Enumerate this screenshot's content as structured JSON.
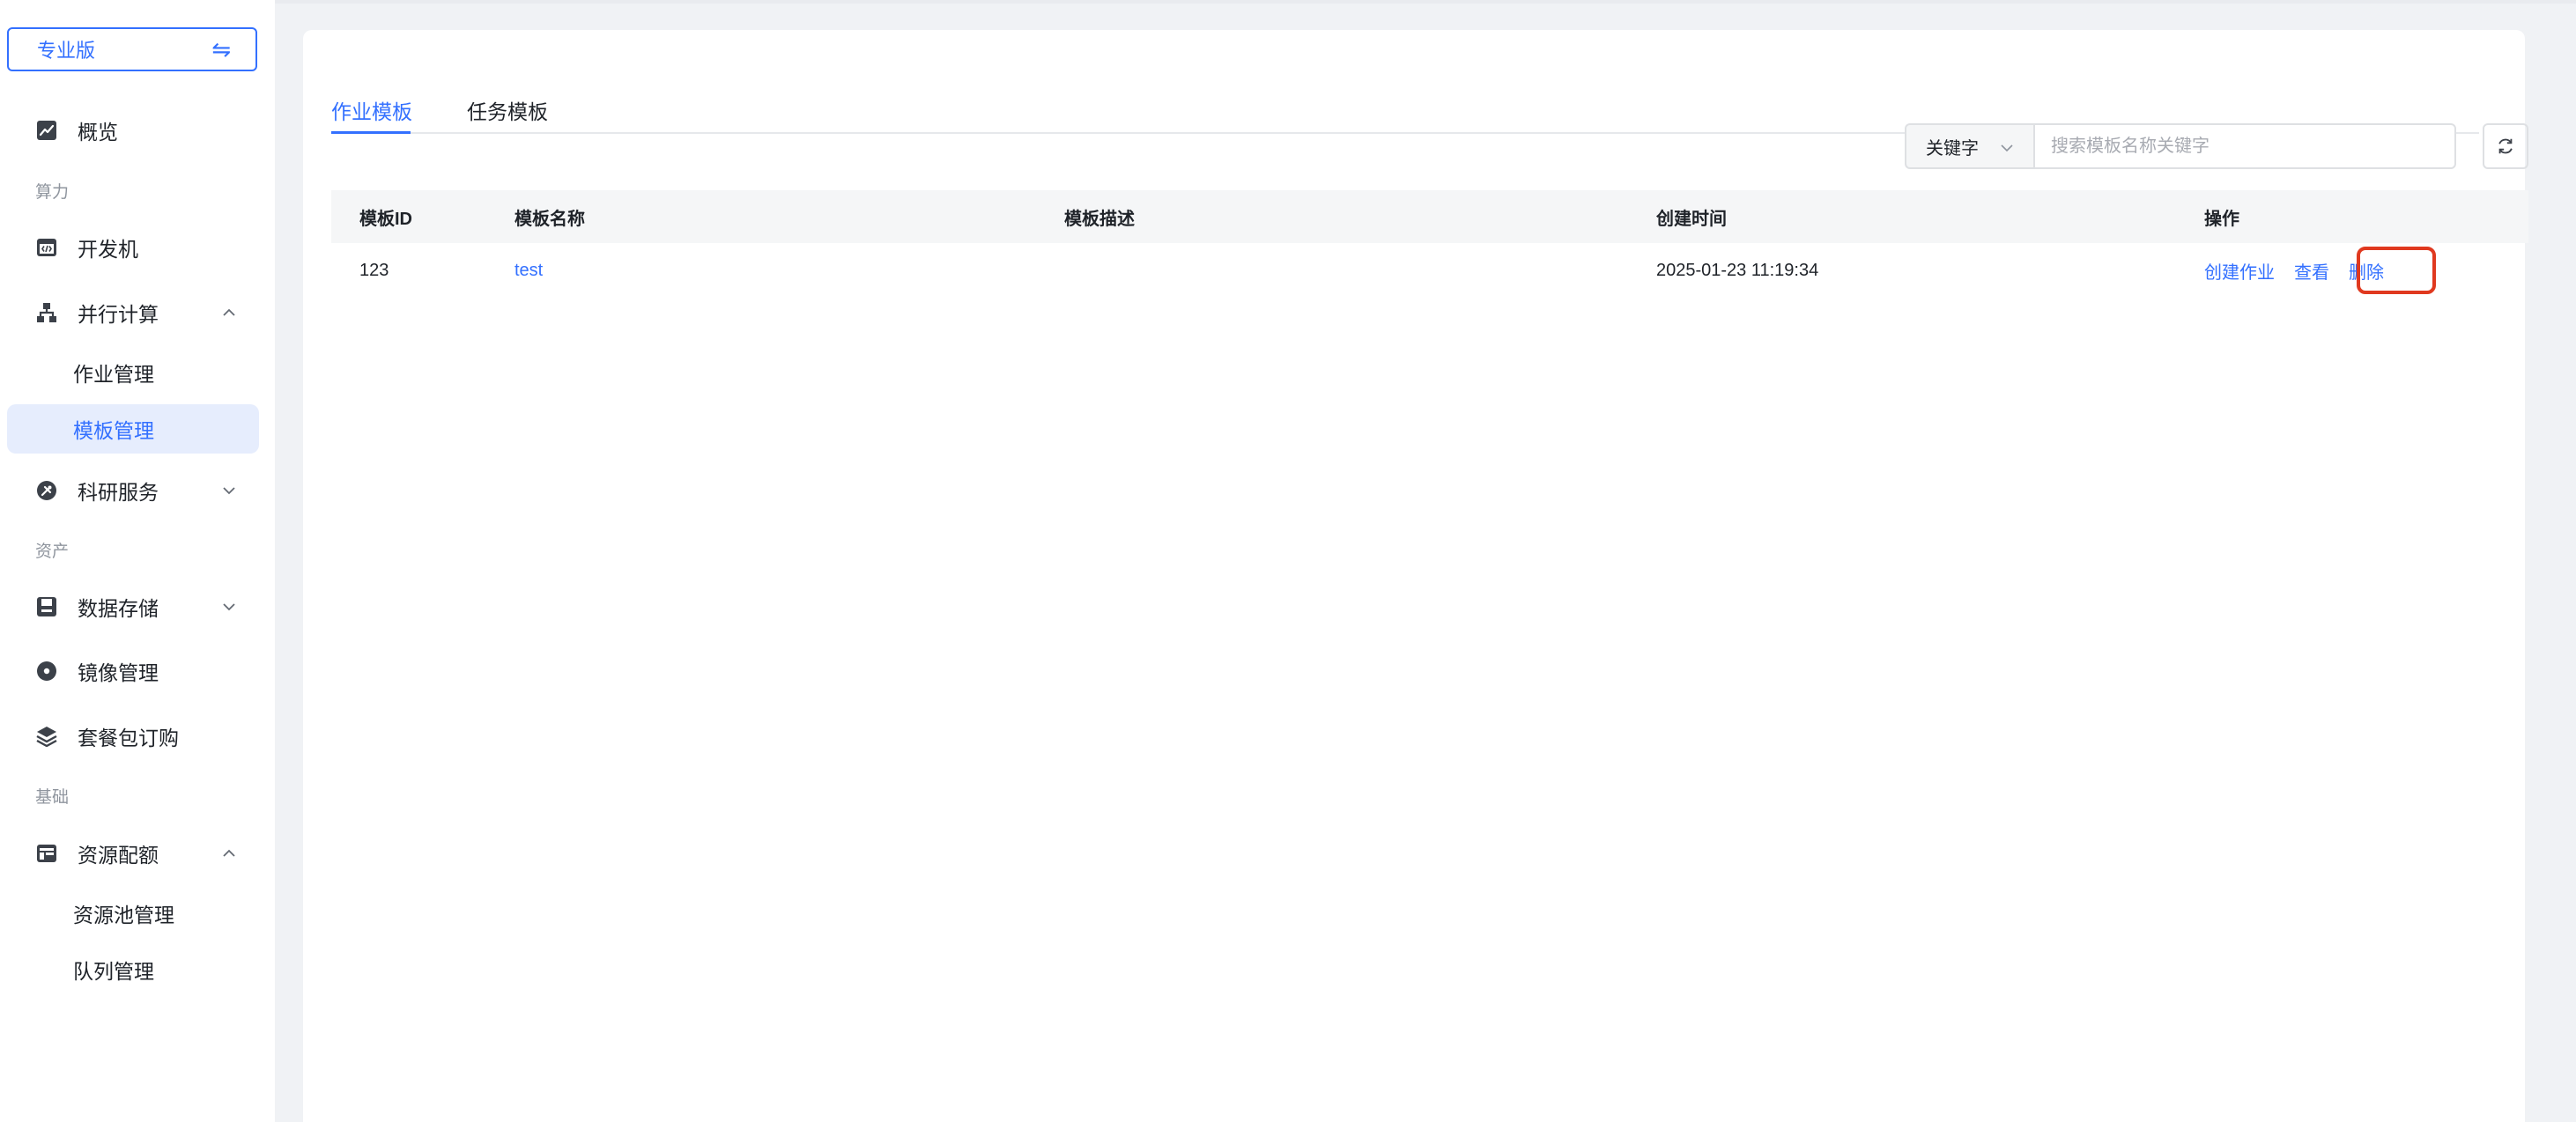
{
  "sidebar": {
    "edition_label": "专业版",
    "swap_icon": "⇋",
    "overview": "概览",
    "groups": {
      "compute": "算力",
      "assets": "资产",
      "basic": "基础"
    },
    "devbox": "开发机",
    "parallel": "并行计算",
    "parallel_children": {
      "jobs": "作业管理",
      "templates": "模板管理"
    },
    "research": "科研服务",
    "storage": "数据存储",
    "images": "镜像管理",
    "packages": "套餐包订购",
    "quota": "资源配额",
    "quota_children": {
      "pools": "资源池管理",
      "queues": "队列管理"
    }
  },
  "tabs": {
    "job_template": "作业模板",
    "task_template": "任务模板"
  },
  "search": {
    "field_label": "关键字",
    "placeholder": "搜索模板名称关键字"
  },
  "table": {
    "headers": {
      "id": "模板ID",
      "name": "模板名称",
      "desc": "模板描述",
      "created": "创建时间",
      "ops": "操作"
    },
    "rows": [
      {
        "id": "123",
        "name": "test",
        "desc": "",
        "created": "2025-01-23 11:19:34",
        "op_create": "创建作业",
        "op_view": "查看",
        "op_delete": "删除"
      }
    ]
  },
  "colors": {
    "accent": "#3370ff",
    "highlight": "#e0391f",
    "active_bg": "#e6edfd"
  }
}
